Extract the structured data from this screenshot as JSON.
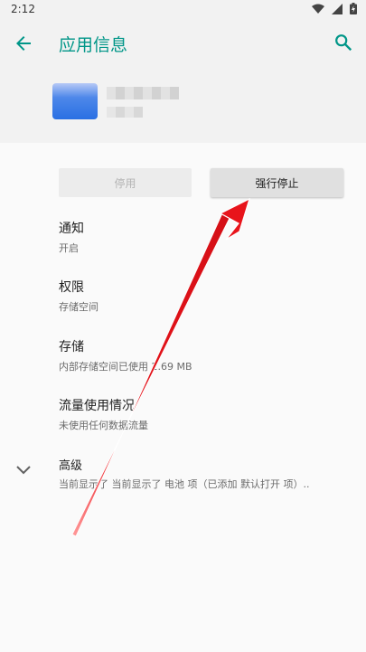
{
  "status_bar": {
    "time": "2:12"
  },
  "header": {
    "title": "应用信息"
  },
  "buttons": {
    "disable": "停用",
    "force_stop": "强行停止"
  },
  "items": [
    {
      "title": "通知",
      "subtitle": "开启"
    },
    {
      "title": "权限",
      "subtitle": "存储空间"
    },
    {
      "title": "存储",
      "subtitle": "内部存储空间已使用 2.69 MB"
    },
    {
      "title": "流量使用情况",
      "subtitle": "未使用任何数据流量"
    },
    {
      "title": "高级",
      "subtitle": "当前显示了 当前显示了 电池 项（已添加 默认打开 项）.."
    }
  ],
  "colors": {
    "accent": "#009688",
    "annotation_arrow": "#e8141b"
  }
}
